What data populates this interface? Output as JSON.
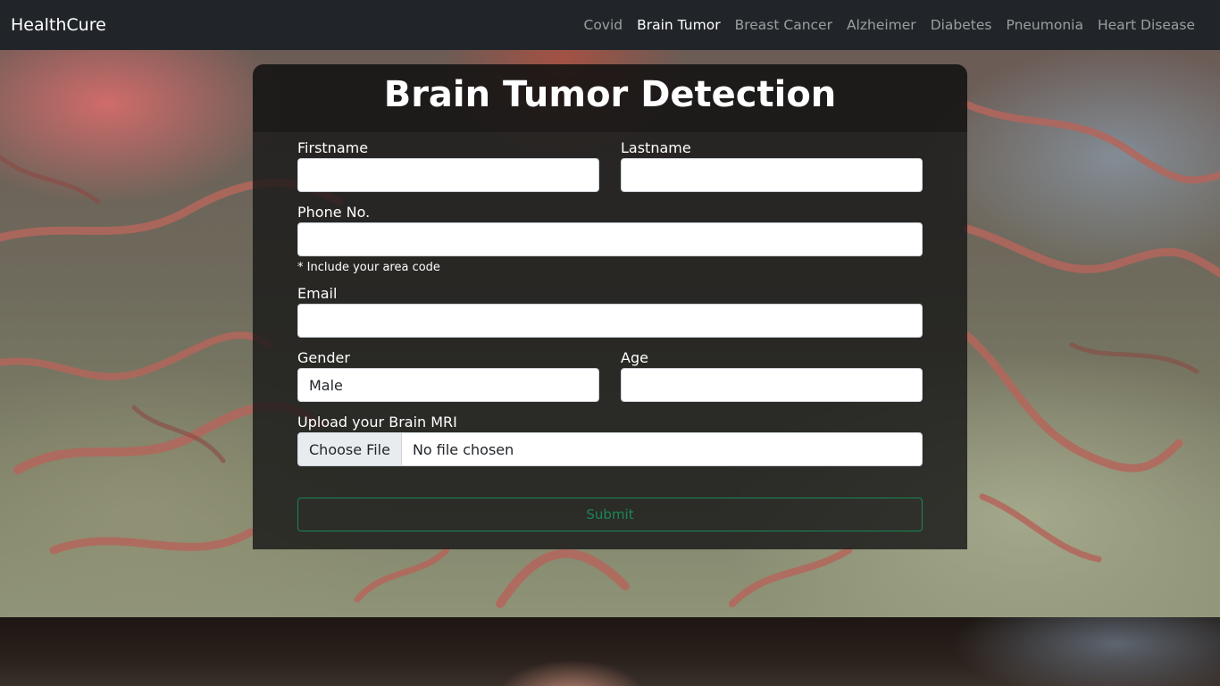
{
  "navbar": {
    "brand": "HealthCure",
    "links": [
      {
        "label": "Covid",
        "active": false
      },
      {
        "label": "Brain Tumor",
        "active": true
      },
      {
        "label": "Breast Cancer",
        "active": false
      },
      {
        "label": "Alzheimer",
        "active": false
      },
      {
        "label": "Diabetes",
        "active": false
      },
      {
        "label": "Pneumonia",
        "active": false
      },
      {
        "label": "Heart Disease",
        "active": false
      }
    ]
  },
  "form": {
    "title": "Brain Tumor Detection",
    "firstname_label": "Firstname",
    "firstname_value": "",
    "lastname_label": "Lastname",
    "lastname_value": "",
    "phone_label": "Phone No.",
    "phone_value": "",
    "phone_hint": "* Include your area code",
    "email_label": "Email",
    "email_value": "",
    "gender_label": "Gender",
    "gender_selected": "Male",
    "age_label": "Age",
    "age_value": "",
    "upload_label": "Upload your Brain MRI",
    "choose_file_label": "Choose File",
    "file_status": "No file chosen",
    "submit_label": "Submit"
  },
  "colors": {
    "navbar_bg": "#212529",
    "submit_accent": "#198754"
  }
}
